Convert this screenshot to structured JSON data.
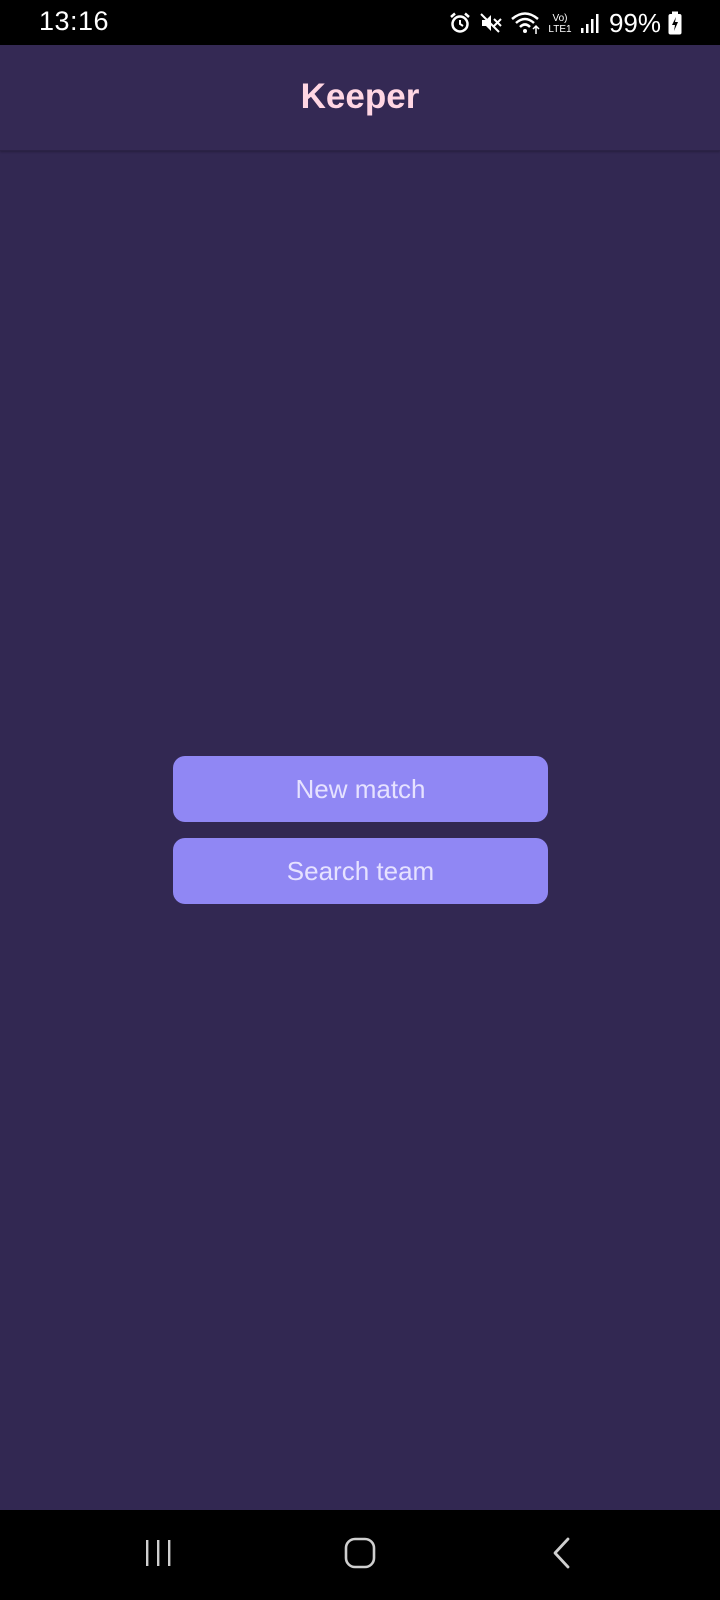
{
  "status_bar": {
    "time": "13:16",
    "battery_percent": "99%",
    "icons": [
      "alarm-icon",
      "mute-icon",
      "wifi-icon",
      "volte-lte-icon",
      "signal-icon",
      "battery-charging-icon"
    ],
    "volte_label": "Vo)",
    "lte_label": "LTE1"
  },
  "app_bar": {
    "title": "Keeper"
  },
  "main": {
    "new_match_label": "New match",
    "search_team_label": "Search team"
  },
  "nav_bar": {
    "icons": [
      "recents-icon",
      "home-icon",
      "back-icon"
    ]
  },
  "colors": {
    "background": "#322852",
    "app_bar": "#342954",
    "title": "#ffd6e3",
    "button": "#9087f4",
    "button_text": "#e6e2ff"
  }
}
